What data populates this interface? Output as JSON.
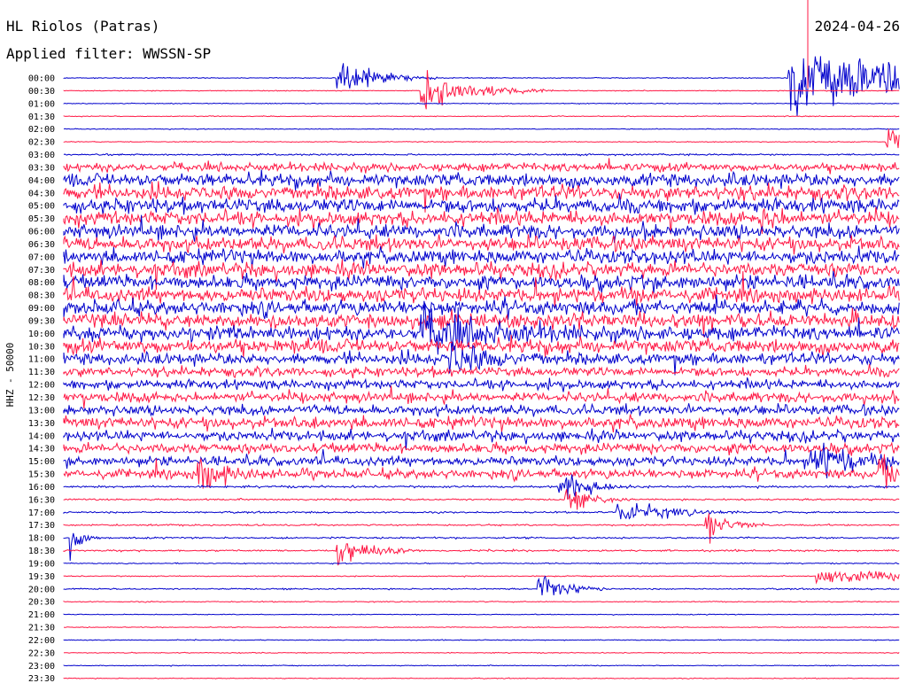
{
  "header": {
    "station": "HL Riolos (Patras)",
    "filter_label": "Applied filter: WWSSN-SP",
    "date": "2024-04-26"
  },
  "chart_data": {
    "type": "line",
    "title": "HL Riolos (Patras)",
    "subtitle": "Applied filter: WWSSN-SP",
    "date": "2024-04-26",
    "ylabel": "HHZ - 50000",
    "row_labels": [
      "00:00",
      "00:30",
      "01:00",
      "01:30",
      "02:00",
      "02:30",
      "03:00",
      "03:30",
      "04:00",
      "04:30",
      "05:00",
      "05:30",
      "06:00",
      "06:30",
      "07:00",
      "07:30",
      "08:00",
      "08:30",
      "09:00",
      "09:30",
      "10:00",
      "10:30",
      "11:00",
      "11:30",
      "12:00",
      "12:30",
      "13:00",
      "13:30",
      "14:00",
      "14:30",
      "15:00",
      "15:30",
      "16:00",
      "16:30",
      "17:00",
      "17:30",
      "18:00",
      "18:30",
      "19:00",
      "19:30",
      "20:00",
      "20:30",
      "21:00",
      "21:30",
      "22:00",
      "22:30",
      "23:00",
      "23:30"
    ],
    "row_minutes": 30,
    "colors": [
      "#0000cc",
      "#ff1744"
    ],
    "noise_level": [
      0.05,
      0.05,
      0.05,
      0.05,
      0.05,
      0.05,
      0.1,
      0.5,
      0.8,
      0.85,
      0.85,
      0.85,
      0.85,
      0.85,
      0.85,
      0.85,
      0.85,
      0.85,
      0.85,
      0.85,
      0.85,
      0.85,
      0.7,
      0.55,
      0.55,
      0.6,
      0.6,
      0.7,
      0.6,
      0.6,
      0.55,
      0.55,
      0.12,
      0.1,
      0.1,
      0.1,
      0.1,
      0.1,
      0.06,
      0.06,
      0.08,
      0.06,
      0.05,
      0.05,
      0.05,
      0.05,
      0.05,
      0.05
    ],
    "events": [
      {
        "row": 0,
        "minute": 9.8,
        "amp": 1.4,
        "dur": 1.2
      },
      {
        "row": 1,
        "minute": 12.8,
        "amp": 1.6,
        "dur": 1.6
      },
      {
        "row": 0,
        "minute": 26.0,
        "amp": 3.0,
        "dur": 4.0
      },
      {
        "row": 5,
        "minute": 29.5,
        "amp": 1.2,
        "dur": 0.6
      },
      {
        "row": 11,
        "minute": 25.0,
        "amp": 1.0,
        "dur": 0.5
      },
      {
        "row": 20,
        "minute": 12.8,
        "amp": 1.6,
        "dur": 2.0
      },
      {
        "row": 22,
        "minute": 13.8,
        "amp": 1.2,
        "dur": 1.2
      },
      {
        "row": 31,
        "minute": 4.8,
        "amp": 1.3,
        "dur": 0.8
      },
      {
        "row": 32,
        "minute": 17.7,
        "amp": 1.6,
        "dur": 0.9
      },
      {
        "row": 33,
        "minute": 18.0,
        "amp": 1.0,
        "dur": 0.8
      },
      {
        "row": 34,
        "minute": 19.8,
        "amp": 1.0,
        "dur": 1.5
      },
      {
        "row": 30,
        "minute": 26.8,
        "amp": 1.8,
        "dur": 1.0
      },
      {
        "row": 31,
        "minute": 29.2,
        "amp": 1.2,
        "dur": 0.6
      },
      {
        "row": 35,
        "minute": 23.0,
        "amp": 1.3,
        "dur": 0.7
      },
      {
        "row": 36,
        "minute": 0.2,
        "amp": 1.2,
        "dur": 0.4
      },
      {
        "row": 37,
        "minute": 9.8,
        "amp": 1.3,
        "dur": 1.0
      },
      {
        "row": 40,
        "minute": 17.0,
        "amp": 1.5,
        "dur": 0.8
      },
      {
        "row": 39,
        "minute": 27.0,
        "amp": 0.6,
        "dur": 3.0
      }
    ]
  }
}
